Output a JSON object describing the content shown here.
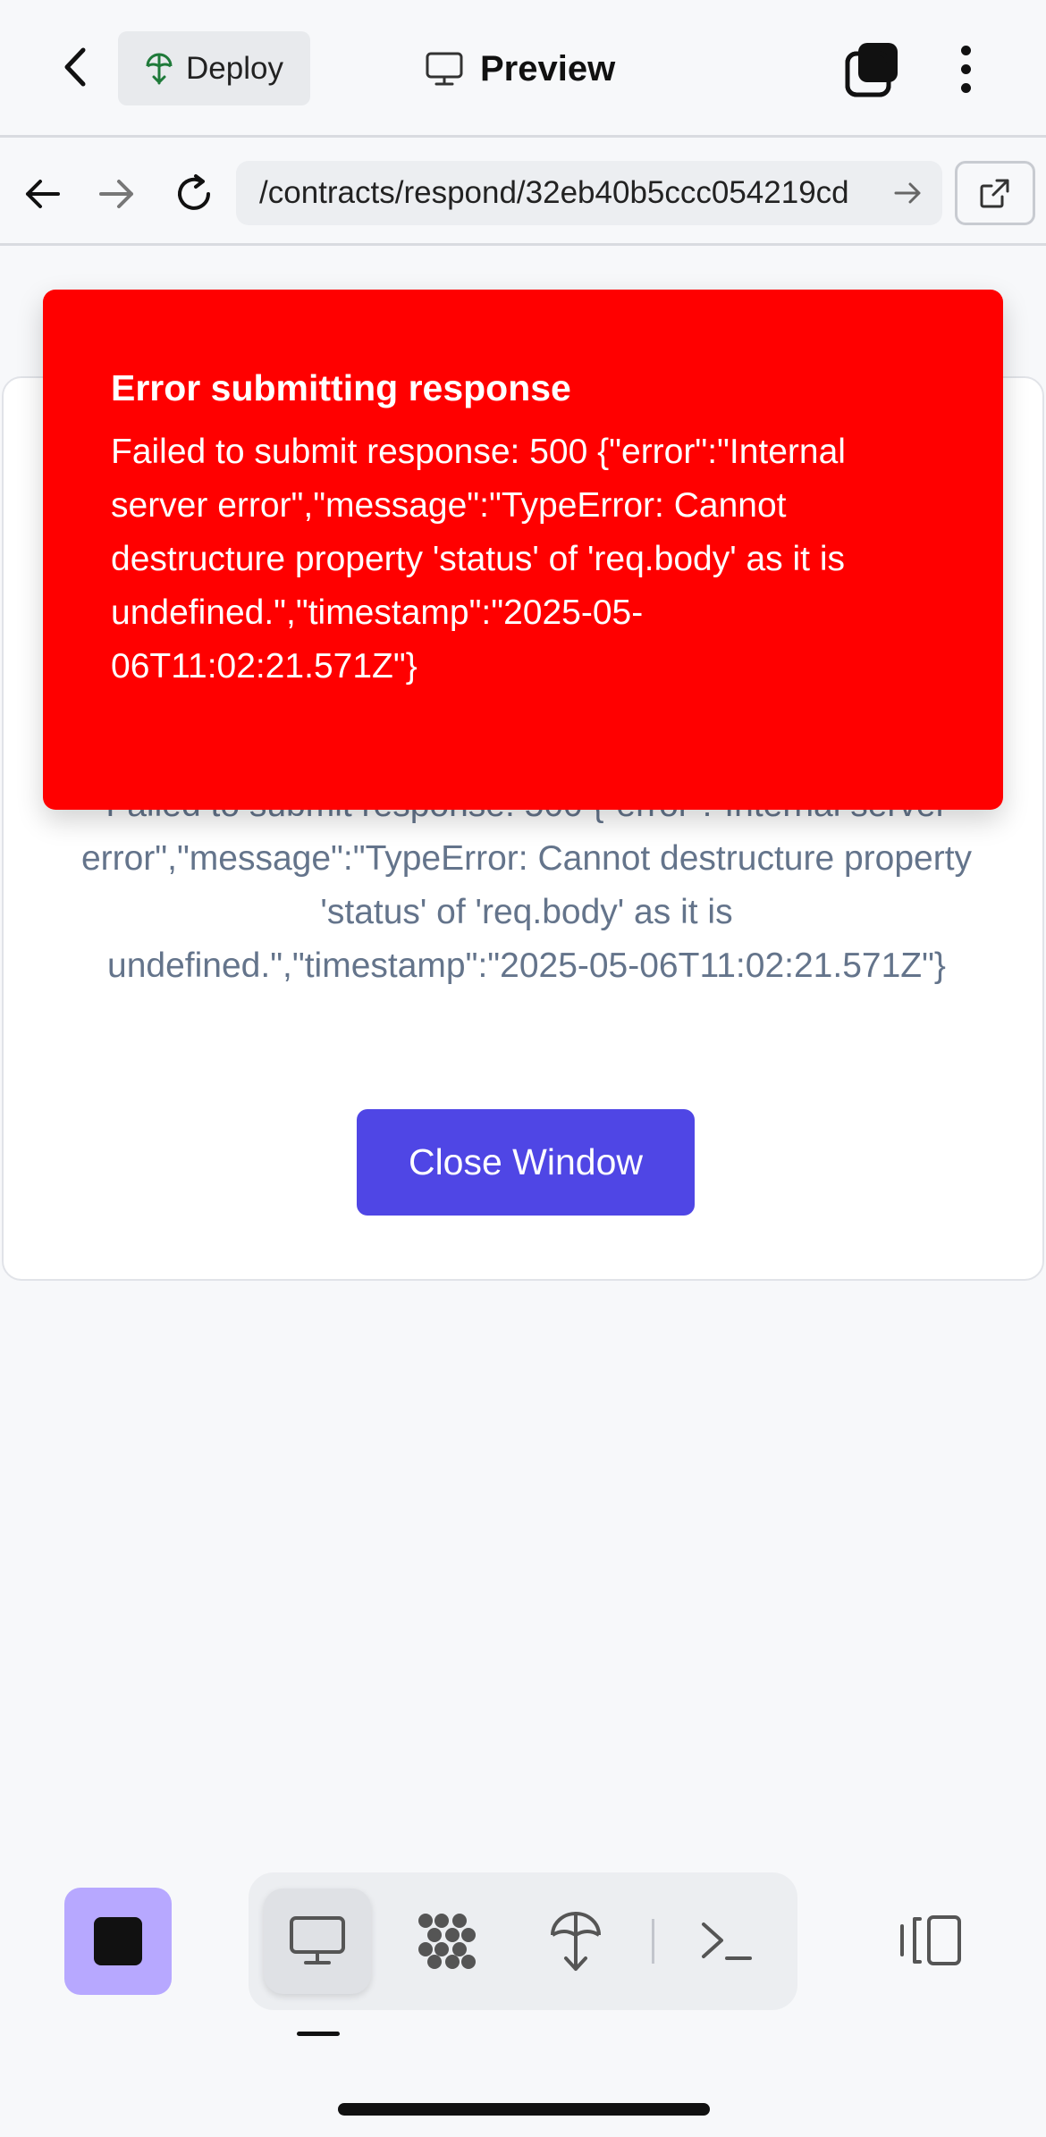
{
  "header": {
    "deploy_label": "Deploy",
    "title": "Preview"
  },
  "browser": {
    "url": "/contracts/respond/32eb40b5ccc054219cd"
  },
  "card": {
    "message": "Failed to submit response: 500 {\"error\":\"Internal server error\",\"message\":\"TypeError: Cannot destructure property 'status' of 'req.body' as it is undefined.\",\"timestamp\":\"2025-05-06T11:02:21.571Z\"}",
    "close_label": "Close Window"
  },
  "toast": {
    "title": "Error submitting response",
    "body": "Failed to submit response: 500 {\"error\":\"Internal server error\",\"message\":\"TypeError: Cannot destructure property 'status' of 'req.body' as it is undefined.\",\"timestamp\":\"2025-05-06T11:02:21.571Z\"}"
  },
  "toolbar": {
    "tools": [
      "monitor-icon",
      "grid-icon",
      "deploy-icon",
      "terminal-icon"
    ],
    "active_tool": "monitor-icon"
  },
  "colors": {
    "toast_bg": "#ff0000",
    "primary_button": "#4f46e5",
    "stop_button_bg": "#b7a8ff"
  }
}
